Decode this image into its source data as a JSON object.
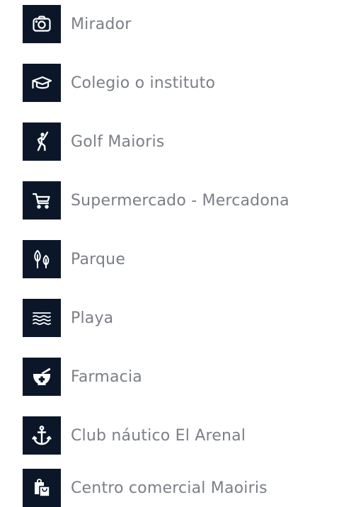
{
  "colors": {
    "icon_background": "#0b1729",
    "icon_foreground": "#ffffff",
    "label_text": "#7b7f86"
  },
  "places": [
    {
      "label": "Mirador",
      "icon": "camera-icon"
    },
    {
      "label": "Colegio o instituto",
      "icon": "graduation-cap-icon"
    },
    {
      "label": "Golf Maioris",
      "icon": "golfer-icon"
    },
    {
      "label": "Supermercado - Mercadona",
      "icon": "shopping-cart-icon"
    },
    {
      "label": "Parque",
      "icon": "trees-icon"
    },
    {
      "label": "Playa",
      "icon": "waves-icon"
    },
    {
      "label": "Farmacia",
      "icon": "pharmacy-mortar-icon"
    },
    {
      "label": "Club náutico El Arenal",
      "icon": "anchor-icon"
    },
    {
      "label": "Centro comercial Maoiris",
      "icon": "shopping-bags-icon"
    }
  ]
}
